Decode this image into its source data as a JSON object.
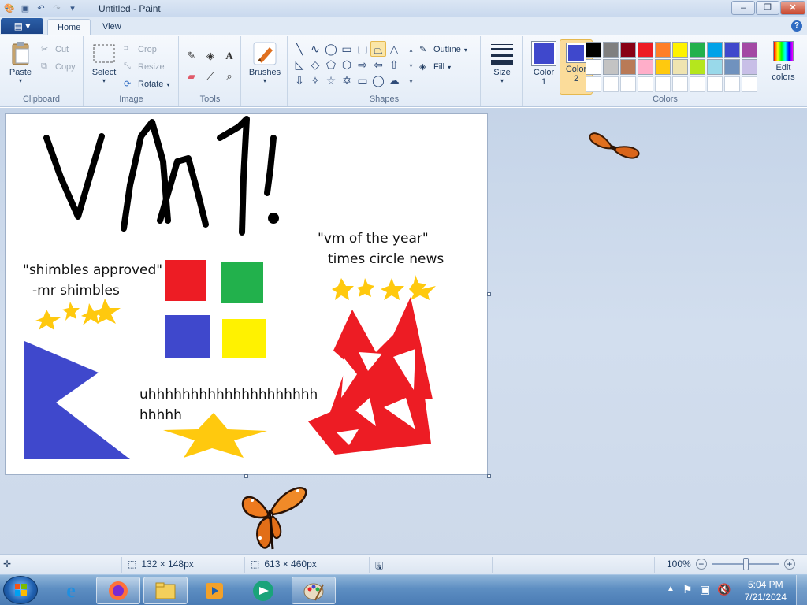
{
  "window": {
    "title": "Untitled - Paint"
  },
  "tabs": [
    {
      "label": "Home"
    },
    {
      "label": "View"
    }
  ],
  "ribbon": {
    "clipboard": {
      "label": "Clipboard",
      "paste": "Paste",
      "cut": "Cut",
      "copy": "Copy"
    },
    "image": {
      "label": "Image",
      "select": "Select",
      "crop": "Crop",
      "resize": "Resize",
      "rotate": "Rotate"
    },
    "tools": {
      "label": "Tools"
    },
    "brushes": {
      "label": "Brushes"
    },
    "shapes": {
      "label": "Shapes",
      "outline": "Outline",
      "fill": "Fill"
    },
    "size": {
      "label": "Size"
    },
    "colors": {
      "label": "Colors",
      "color1_line1": "Color",
      "color1_line2": "1",
      "color2_line1": "Color",
      "color2_line2": "2",
      "edit_line1": "Edit",
      "edit_line2": "colors",
      "color1_value": "#3f48cc",
      "color2_value": "#3f48cc",
      "palette": [
        "#000000",
        "#7f7f7f",
        "#880015",
        "#ed1c24",
        "#ff7f27",
        "#fff200",
        "#22b14c",
        "#00a2e8",
        "#3f48cc",
        "#a349a4",
        "#ffffff",
        "#c3c3c3",
        "#b97a57",
        "#ffaec9",
        "#ffc90e",
        "#efe4b0",
        "#b5e61d",
        "#99d9ea",
        "#7092be",
        "#c8bfe7",
        "",
        "",
        "",
        "",
        "",
        "",
        "",
        "",
        "",
        ""
      ]
    }
  },
  "canvas": {
    "quote1_line1": "\"shimbles approved\"",
    "quote1_line2": "-mr shimbles",
    "quote2_line1": "\"vm of the year\"",
    "quote2_line2": "times circle news",
    "filler_line1": "uhhhhhhhhhhhhhhhhhhhh",
    "filler_line2": "hhhhh"
  },
  "statusbar": {
    "selection_size": "132 × 148px",
    "canvas_size": "613 × 460px",
    "zoom": "100%"
  },
  "taskbar": {
    "time": "5:04 PM",
    "date": "7/21/2024"
  }
}
